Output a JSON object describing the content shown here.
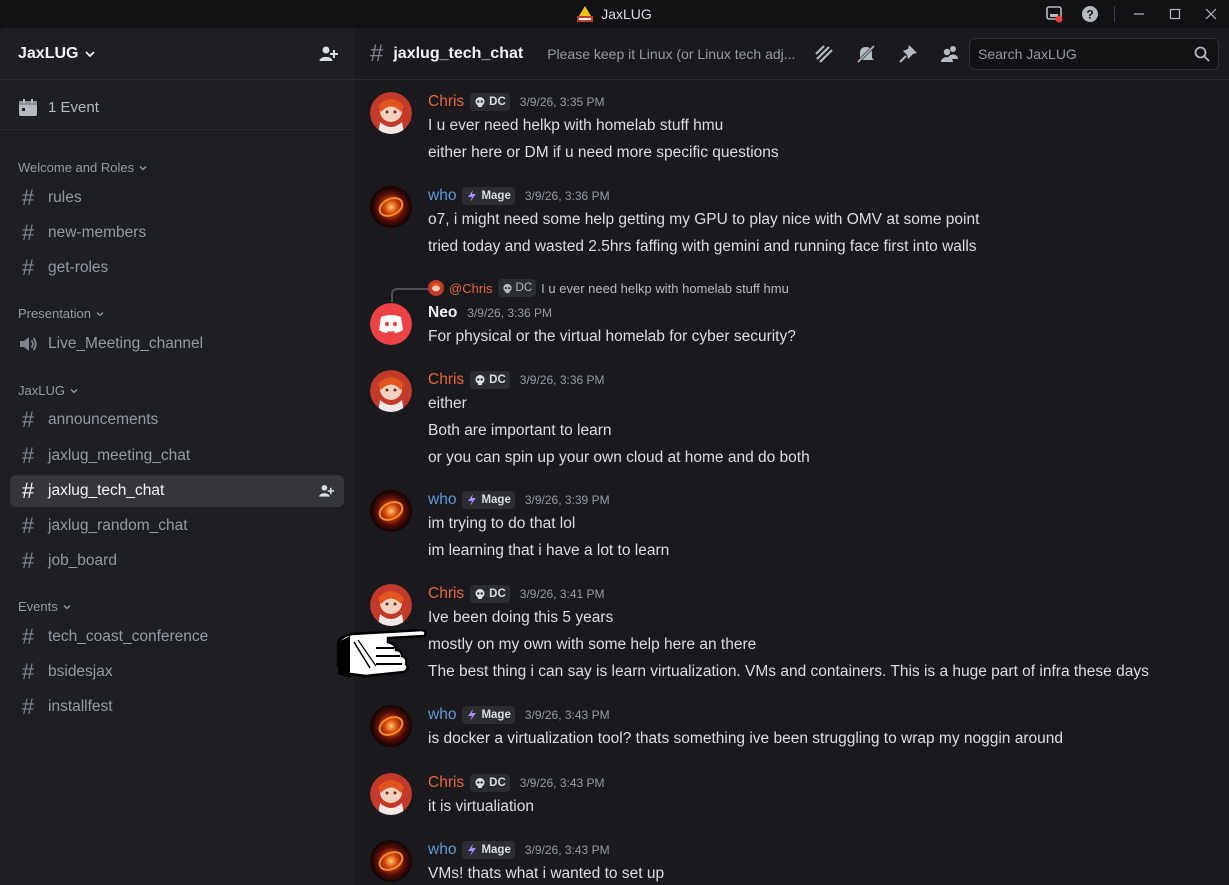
{
  "window": {
    "title": "JaxLUG"
  },
  "sidebar": {
    "server_name": "JaxLUG",
    "events_label": "1 Event",
    "categories": {
      "welcome": "Welcome and Roles",
      "presentation": "Presentation",
      "jaxlug": "JaxLUG",
      "events": "Events"
    },
    "channels": {
      "rules": "rules",
      "new_members": "new-members",
      "get_roles": "get-roles",
      "live_meeting": "Live_Meeting_channel",
      "announcements": "announcements",
      "meeting_chat": "jaxlug_meeting_chat",
      "tech_chat": "jaxlug_tech_chat",
      "random_chat": "jaxlug_random_chat",
      "job_board": "job_board",
      "tech_coast": "tech_coast_conference",
      "bsidesjax": "bsidesjax",
      "installfest": "installfest"
    }
  },
  "header": {
    "channel": "jaxlug_tech_chat",
    "topic": "Please keep it Linux (or Linux tech adj...",
    "search_placeholder": "Search JaxLUG"
  },
  "tags": {
    "chris": "DC",
    "who": "Mage"
  },
  "messages": [
    {
      "author": "Chris",
      "time": "3/9/26, 3:35 PM",
      "lines": [
        "I u ever need helkp with homelab stuff hmu",
        "either here or DM if u need more specific questions"
      ]
    },
    {
      "author": "who",
      "time": "3/9/26, 3:36 PM",
      "lines": [
        "o7, i might need some help getting my GPU to play nice with OMV at some point",
        "tried today and wasted 2.5hrs faffing with gemini and running face first into walls"
      ]
    },
    {
      "author": "Neo",
      "time": "3/9/26, 3:36 PM",
      "reply_author": "@Chris",
      "reply_tag": "DC",
      "reply_text": "I u ever need helkp with homelab stuff hmu",
      "lines": [
        "For physical or the virtual homelab for cyber security?"
      ]
    },
    {
      "author": "Chris",
      "time": "3/9/26, 3:36 PM",
      "lines": [
        "either",
        "Both are important to learn",
        "or you can spin up your own cloud at home and do both"
      ]
    },
    {
      "author": "who",
      "time": "3/9/26, 3:39 PM",
      "lines": [
        "im trying to do that lol",
        "im learning that i have a lot to learn"
      ]
    },
    {
      "author": "Chris",
      "time": "3/9/26, 3:41 PM",
      "lines": [
        "Ive been doing this 5 years",
        "mostly on my own with some help here an there",
        "The best thing i can say is learn virtualization. VMs and containers. This is a huge part of infra these days"
      ]
    },
    {
      "author": "who",
      "time": "3/9/26, 3:43 PM",
      "lines": [
        "is docker a virtualization tool? thats something ive been struggling to wrap my noggin around"
      ]
    },
    {
      "author": "Chris",
      "time": "3/9/26, 3:43 PM",
      "lines": [
        "it is virtualiation"
      ]
    },
    {
      "author": "who",
      "time": "3/9/26, 3:43 PM",
      "lines": [
        "VMs! thats what i wanted to set up"
      ]
    }
  ],
  "colors": {
    "chris": "#e8663d",
    "who": "#5d9bd6",
    "neo_avatar": "#ed4245",
    "active_channel": "#35363c"
  }
}
